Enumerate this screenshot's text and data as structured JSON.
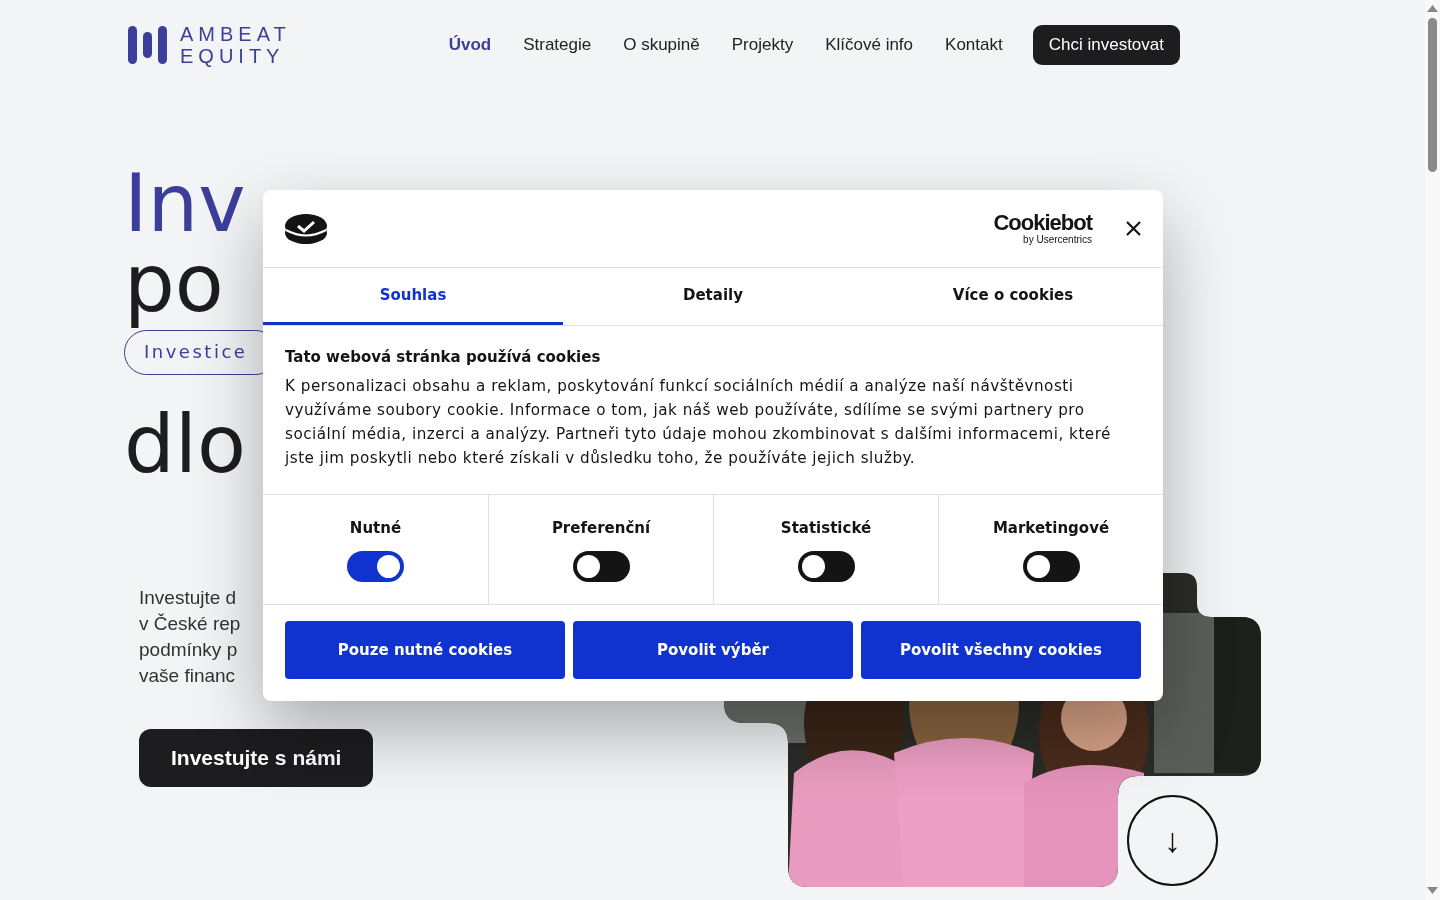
{
  "header": {
    "logo": {
      "line_1": "AMBEAT",
      "line_2": "EQUITY"
    },
    "nav": [
      {
        "label": "Úvod",
        "selected": true
      },
      {
        "label": "Strategie",
        "selected": false
      },
      {
        "label": "O skupině",
        "selected": false
      },
      {
        "label": "Projekty",
        "selected": false
      },
      {
        "label": "Klíčové info",
        "selected": false
      },
      {
        "label": "Kontakt",
        "selected": false
      }
    ],
    "cta": "Chci investovat"
  },
  "hero": {
    "line_1": "Inv",
    "line_2": "po",
    "tag": "Investice",
    "line_3": "dlo",
    "intro_lines": [
      "Investujte d",
      "v České rep",
      "podmínky p",
      "vaše financ"
    ],
    "button": "Investujte s námi",
    "scroll_button": "↓"
  },
  "cookie_dialog": {
    "brand": {
      "name": "Cookiebot",
      "byline": "by Usercentrics"
    },
    "tabs": [
      {
        "label": "Souhlas",
        "selected": true
      },
      {
        "label": "Detaily",
        "selected": false
      },
      {
        "label": "Více o cookies",
        "selected": false
      }
    ],
    "title": "Tato webová stránka používá cookies",
    "text": "K personalizaci obsahu a reklam, poskytování funkcí sociálních médií a analýze naší návštěvnosti využíváme soubory cookie. Informace o tom, jak náš web používáte, sdílíme se svými partnery pro sociální média, inzerci a analýzy. Partneři tyto údaje mohou zkombinovat s dalšími informacemi, které jste jim poskytli nebo které získali v důsledku toho, že používáte jejich služby.",
    "categories": [
      {
        "label": "Nutné",
        "checked": true
      },
      {
        "label": "Preferenční",
        "checked": false
      },
      {
        "label": "Statistické",
        "checked": false
      },
      {
        "label": "Marketingové",
        "checked": false
      }
    ],
    "buttons": [
      "Pouze nutné cookies",
      "Povolit výběr",
      "Povolit všechny cookies"
    ]
  }
}
